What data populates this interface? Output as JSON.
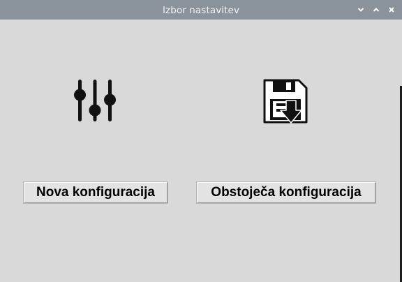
{
  "window": {
    "title": "Izbor nastavitev",
    "controls": {
      "minimize_icon": "chevron-down-icon",
      "maximize_icon": "chevron-up-icon",
      "close_icon": "close-icon"
    }
  },
  "options": {
    "new_config": {
      "icon": "sliders-icon",
      "label": "Nova konfiguracija"
    },
    "existing_config": {
      "icon": "floppy-save-icon",
      "label": "Obstoječa konfiguracija"
    }
  },
  "colors": {
    "titlebar": "#8a929c",
    "background": "#d9d9d9",
    "button_face": "#e3e3e3",
    "icon": "#111111"
  }
}
